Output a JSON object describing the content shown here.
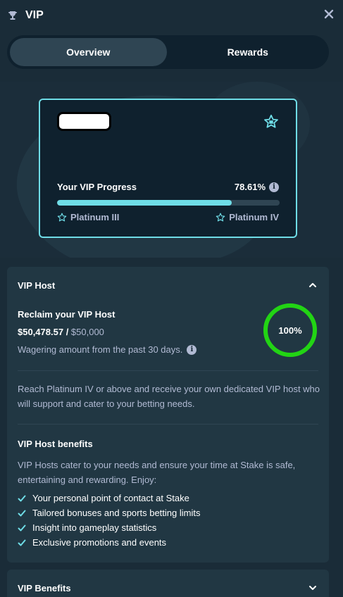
{
  "header": {
    "title": "VIP",
    "icon": "trophy-icon",
    "close_icon": "close-icon"
  },
  "tabs": [
    {
      "label": "Overview",
      "active": true
    },
    {
      "label": "Rewards",
      "active": false
    }
  ],
  "vip_card": {
    "progress_label": "Your VIP Progress",
    "progress_percent_text": "78.61%",
    "progress_value": 78.61,
    "current_tier": "Platinum III",
    "next_tier": "Platinum IV",
    "accent": "#6fdde7"
  },
  "vip_host": {
    "title": "VIP Host",
    "reclaim_title": "Reclaim your VIP Host",
    "amount_current": "$50,478.57",
    "amount_separator": " / ",
    "amount_target": "$50,000",
    "wager_note": "Wagering amount from the past 30 days.",
    "ring_text": "100%",
    "ring_value": 100,
    "ring_color": "#22d414",
    "description": "Reach Platinum IV or above and receive your own dedicated VIP host who will support and cater to your betting needs.",
    "benefits_title": "VIP Host benefits",
    "benefits_desc": "VIP Hosts cater to your needs and ensure your time at Stake is safe, entertaining and rewarding. Enjoy:",
    "benefits": [
      "Your personal point of contact at Stake",
      "Tailored bonuses and sports betting limits",
      "Insight into gameplay statistics",
      "Exclusive promotions and events"
    ]
  },
  "vip_benefits": {
    "title": "VIP Benefits"
  },
  "colors": {
    "background": "#1a2c38",
    "panel": "#213743",
    "muted_text": "#b1bad3"
  }
}
